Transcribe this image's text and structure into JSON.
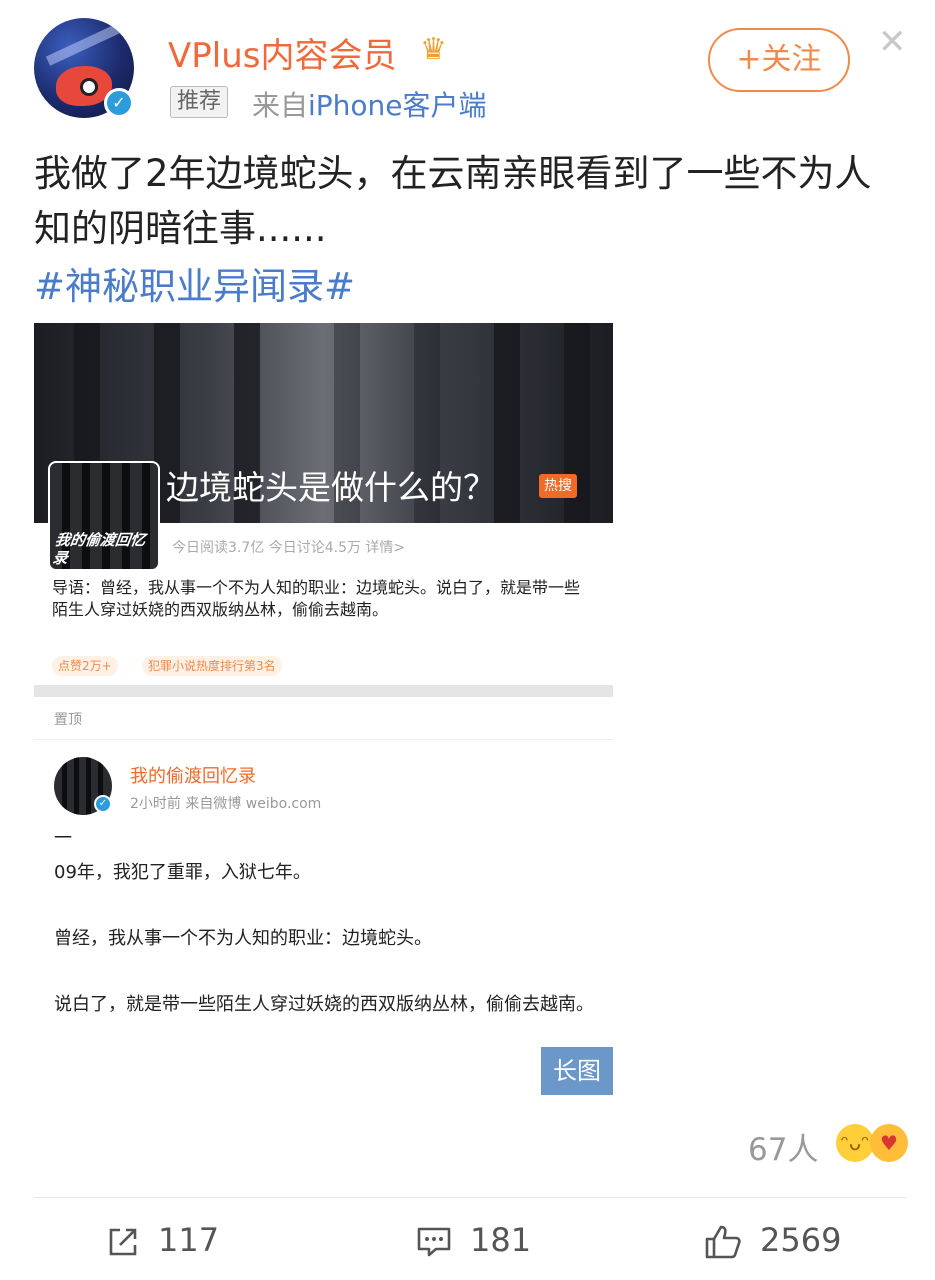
{
  "post": {
    "username": "VPlus内容会员",
    "crown_icon": "crown-icon",
    "tag": "推荐",
    "from_prefix": "来自",
    "from_source": "iPhone客户端",
    "follow_label": "+关注",
    "close_icon": "close-icon",
    "text": "我做了2年边境蛇头，在云南亲眼看到了一些不为人知的阴暗往事......",
    "hashtag": "#神秘职业异闻录#"
  },
  "embed": {
    "banner_title": "边境蛇头是做什么的？",
    "hot_badge": "热搜",
    "thumb_text": "我的偷渡回忆录",
    "stats": "今日阅读3.7亿   今日讨论4.5万   详情>",
    "lead": "导语：曾经，我从事一个不为人知的职业：边境蛇头。说白了，就是带一些陌生人穿过妖娆的西双版纳丛林，偷偷去越南。",
    "pill1": "点赞2万+",
    "pill2": "犯罪小说热度排行第3名",
    "pinned": "置顶",
    "author": "我的偷渡回忆录",
    "meta": "2小时前  来自微博 weibo.com",
    "paragraphs": [
      "一",
      "09年，我犯了重罪，入狱七年。",
      "曾经，我从事一个不为人知的职业：边境蛇头。",
      "说白了，就是带一些陌生人穿过妖娆的西双版纳丛林，偷偷去越南。"
    ],
    "long_image_label": "长图"
  },
  "reactions": {
    "count": "67人"
  },
  "actions": {
    "repost_count": "117",
    "comment_count": "181",
    "like_count": "2569"
  },
  "colors": {
    "brand_orange": "#f1693a",
    "link_blue": "#4a7cc9"
  }
}
